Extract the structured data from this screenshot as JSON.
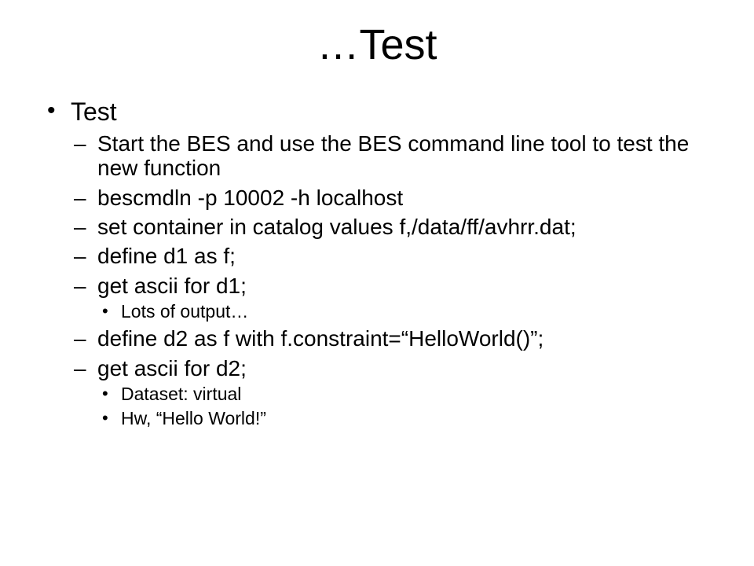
{
  "title": "…Test",
  "l1": {
    "item0": "Test"
  },
  "l2": {
    "item0": "Start the BES and use the BES command line tool to test the new function",
    "item1": "bescmdln -p 10002 -h localhost",
    "item2": "set container in catalog values f,/data/ff/avhrr.dat;",
    "item3": "define d1 as f;",
    "item4": "get ascii for d1;",
    "item5": "define d2 as f with f.constraint=“HelloWorld()”;",
    "item6": "get ascii for d2;"
  },
  "l3": {
    "item0": "Lots of output…",
    "item1": "Dataset: virtual",
    "item2": "Hw, “Hello World!”"
  }
}
